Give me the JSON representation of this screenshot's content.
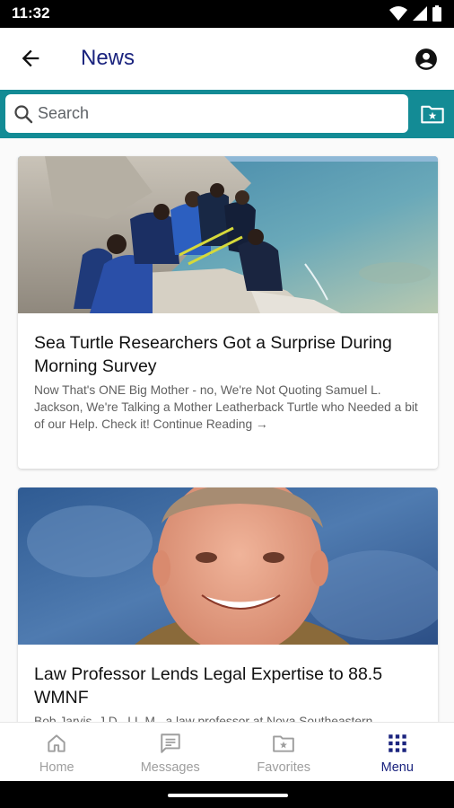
{
  "status_bar": {
    "time": "11:32"
  },
  "app_bar": {
    "title": "News"
  },
  "search": {
    "placeholder": "Search"
  },
  "articles": [
    {
      "title": "Sea Turtle Researchers Got a Surprise During Morning Survey",
      "summary": "Now That's ONE Big Mother - no, We're Not Quoting Samuel L. Jackson, We're Talking a Mother Leatherback Turtle who Needed a bit of our Help. Check it! Continue Reading →"
    },
    {
      "title": "Law Professor Lends Legal Expertise to 88.5 WMNF",
      "summary": "Bob Jarvis, J.D., LL.M., a law professor at Nova Southeastern"
    }
  ],
  "bottom_nav": [
    {
      "label": "Home",
      "icon": "home-icon",
      "active": false
    },
    {
      "label": "Messages",
      "icon": "messages-icon",
      "active": false
    },
    {
      "label": "Favorites",
      "icon": "favorites-icon",
      "active": false
    },
    {
      "label": "Menu",
      "icon": "menu-grid-icon",
      "active": true
    }
  ],
  "colors": {
    "accent": "#138b95",
    "title": "#1a237e",
    "inactive": "#9e9e9e"
  }
}
